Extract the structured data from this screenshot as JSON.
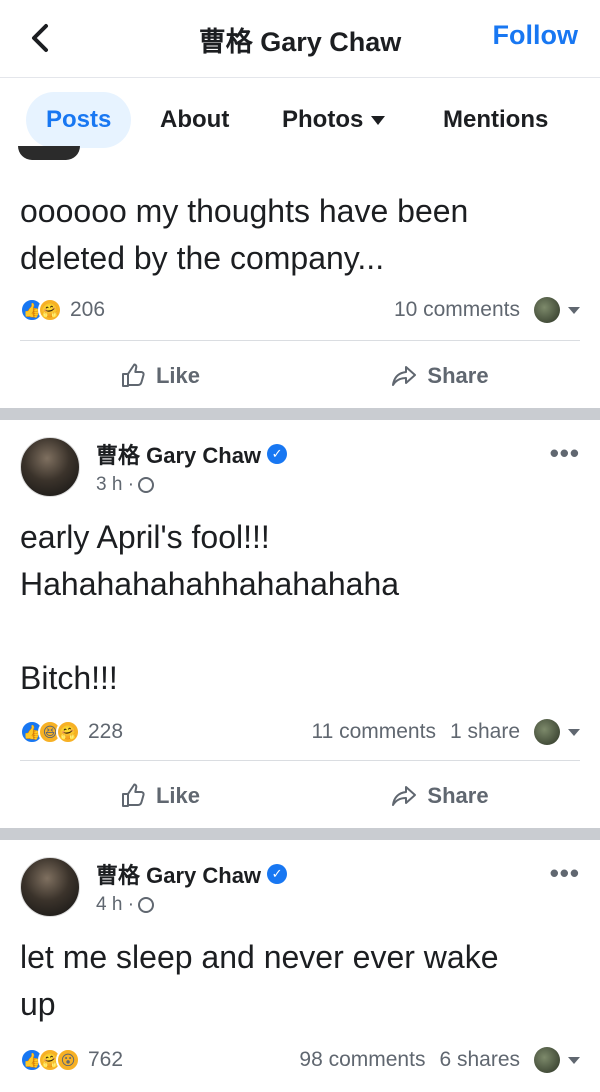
{
  "header": {
    "title": "曹格 Gary Chaw",
    "follow_label": "Follow"
  },
  "tabs": [
    {
      "label": "Posts",
      "active": true
    },
    {
      "label": "About",
      "active": false
    },
    {
      "label": "Photos",
      "active": false,
      "dropdown": true
    },
    {
      "label": "Mentions",
      "active": false
    }
  ],
  "accent_color": "#1877f2",
  "posts": [
    {
      "text": "oooooo my thoughts have been\ndeleted by the company...",
      "reaction_count": "206",
      "comments": "10 comments",
      "shares": "",
      "like_label": "Like",
      "share_label": "Share"
    },
    {
      "author": "曹格 Gary Chaw",
      "time": "3 h ·",
      "text": "early April's fool!!!\nHahahahahahhahahahaha\n\nBitch!!!",
      "reaction_count": "228",
      "comments": "11 comments",
      "shares": "1 share",
      "like_label": "Like",
      "share_label": "Share"
    },
    {
      "author": "曹格 Gary Chaw",
      "time": "4 h ·",
      "text": "let me sleep and never ever wake\nup",
      "reaction_count": "762",
      "comments": "98 comments",
      "shares": "6 shares"
    }
  ]
}
